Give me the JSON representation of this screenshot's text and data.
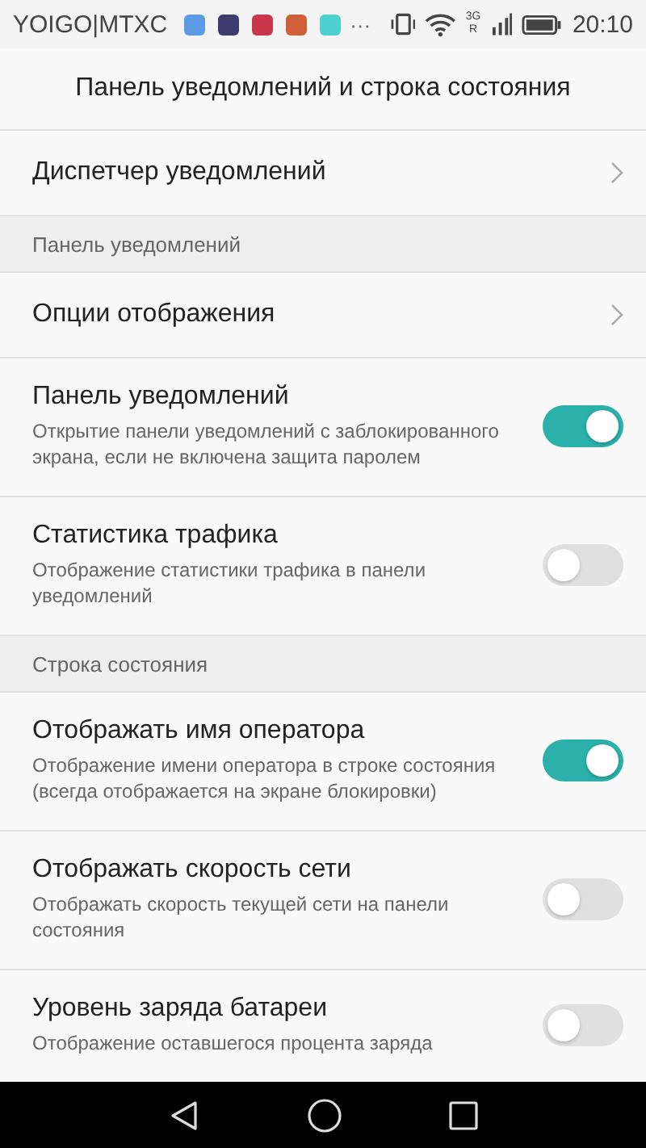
{
  "status_bar": {
    "carrier": "YOIGO|MTXC",
    "notification_icons": [
      {
        "color": "#5b9be6"
      },
      {
        "color": "#3c3c6e"
      },
      {
        "color": "#c8384a"
      },
      {
        "color": "#d0603a"
      },
      {
        "color": "#4fd0d0"
      }
    ],
    "more": "···",
    "network": "3G",
    "roaming": "R",
    "time": "20:10"
  },
  "title": "Панель уведомлений и строка состояния",
  "items": [
    {
      "kind": "nav",
      "title": "Диспетчер уведомлений"
    },
    {
      "kind": "header",
      "title": "Панель уведомлений"
    },
    {
      "kind": "nav",
      "title": "Опции отображения"
    },
    {
      "kind": "toggle",
      "title": "Панель уведомлений",
      "description": "Открытие панели уведомлений с заблокированного экрана, если не включена защита паролем",
      "on": true
    },
    {
      "kind": "toggle",
      "title": "Статистика трафика",
      "description": "Отображение статистики трафика в панели уведомлений",
      "on": false
    },
    {
      "kind": "header",
      "title": "Строка состояния"
    },
    {
      "kind": "toggle",
      "title": "Отображать имя оператора",
      "description": "Отображение имени оператора в строке состояния (всегда отображается на экране блокировки)",
      "on": true
    },
    {
      "kind": "toggle",
      "title": "Отображать скорость сети",
      "description": "Отображать скорость текущей сети на панели состояния",
      "on": false
    },
    {
      "kind": "toggle",
      "title": "Уровень заряда батареи",
      "description": "Отображение оставшегося процента заряда",
      "on": false
    }
  ]
}
